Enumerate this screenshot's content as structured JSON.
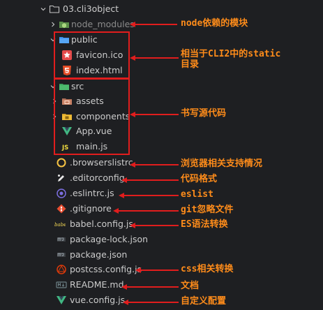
{
  "explorer": {
    "root": {
      "label": "03.cli3object",
      "icon": "folder-icon"
    },
    "items": [
      {
        "label": "node_modules",
        "icon": "node-folder-icon"
      },
      {
        "label": "public",
        "icon": "folder-icon"
      },
      {
        "label": "favicon.ico",
        "icon": "star-icon"
      },
      {
        "label": "index.html",
        "icon": "html5-icon"
      },
      {
        "label": "src",
        "icon": "folder-icon"
      },
      {
        "label": "assets",
        "icon": "folder-icon"
      },
      {
        "label": "components",
        "icon": "folder-icon"
      },
      {
        "label": "App.vue",
        "icon": "vue-icon"
      },
      {
        "label": "main.js",
        "icon": "js-icon"
      },
      {
        "label": ".browserslistrc",
        "icon": "browserslist-icon"
      },
      {
        "label": ".editorconfig",
        "icon": "editorconfig-icon"
      },
      {
        "label": ".eslintrc.js",
        "icon": "eslint-icon"
      },
      {
        "label": ".gitignore",
        "icon": "git-icon"
      },
      {
        "label": "babel.config.js",
        "icon": "babel-icon"
      },
      {
        "label": "package-lock.json",
        "icon": "npm-icon"
      },
      {
        "label": "package.json",
        "icon": "npm-icon"
      },
      {
        "label": "postcss.config.js",
        "icon": "postcss-icon"
      },
      {
        "label": "README.md",
        "icon": "markdown-icon"
      },
      {
        "label": "vue.config.js",
        "icon": "vue-icon"
      }
    ]
  },
  "annotations": {
    "node_modules": "node依赖的模块",
    "public_line1": "相当于CLI2中的static",
    "public_line2": "目录",
    "src": "书写源代码",
    "browserslistrc": "浏览器相关支持情况",
    "editorconfig": "代码格式",
    "eslintrc": "eslist",
    "gitignore": "git忽略文件",
    "babel": "ES语法转换",
    "postcss": "css相关转换",
    "readme": "文档",
    "vueconfig": "自定义配置"
  },
  "colors": {
    "background": "#1e1f22",
    "highlight": "#e11d1d",
    "annotation": "#ff8c1a"
  }
}
